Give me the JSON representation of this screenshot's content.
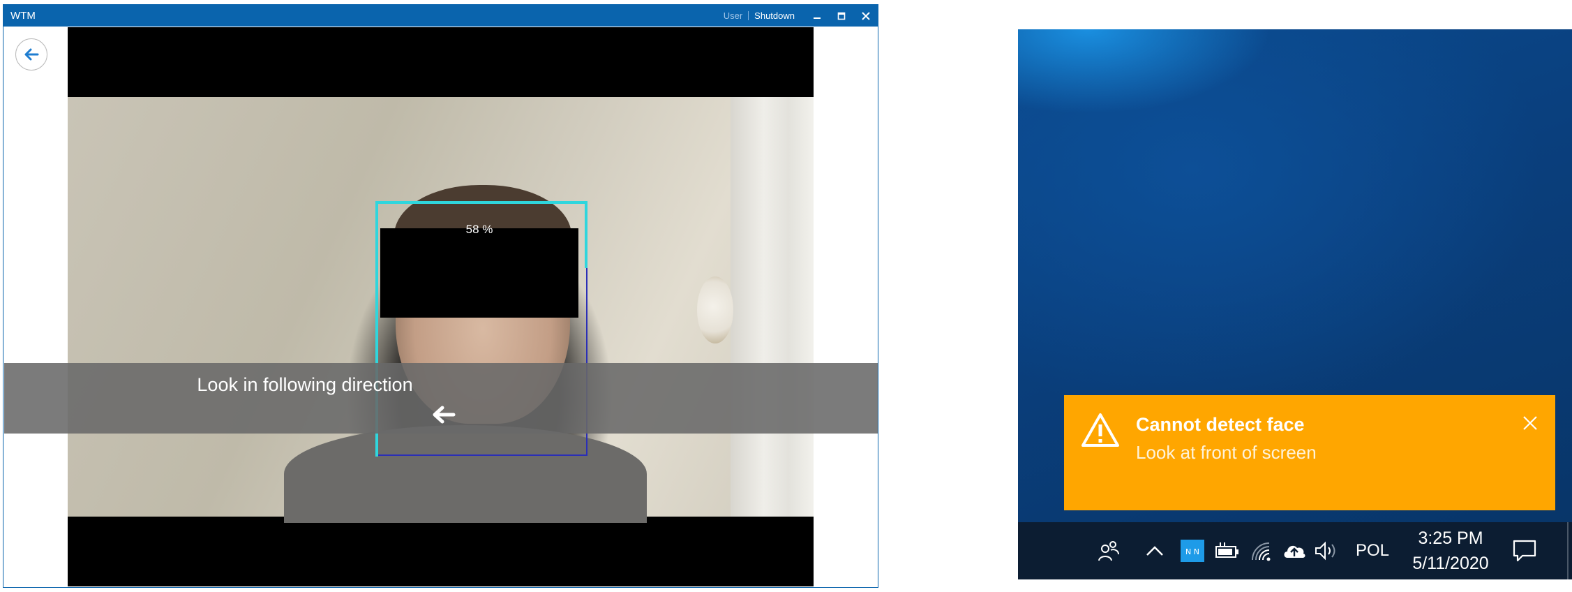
{
  "window": {
    "title": "WTM",
    "user_label": "User",
    "shutdown_label": "Shutdown",
    "accent_color": "#0a64ad"
  },
  "camera": {
    "confidence_label": "58 %",
    "guide_text": "Look in following direction",
    "direction_icon": "arrow-left-icon",
    "box_color": "#2fd6dd"
  },
  "toast": {
    "title": "Cannot detect face",
    "message": "Look at front of screen",
    "icon": "warning-icon",
    "background_color": "#ffa600"
  },
  "taskbar": {
    "language": "POL",
    "time": "3:25 PM",
    "date": "5/11/2020",
    "tray_icons": [
      "people-icon",
      "chevron-up-icon",
      "app-tray-icon",
      "battery-icon",
      "wifi-icon",
      "onedrive-icon",
      "volume-icon",
      "notification-icon"
    ]
  }
}
